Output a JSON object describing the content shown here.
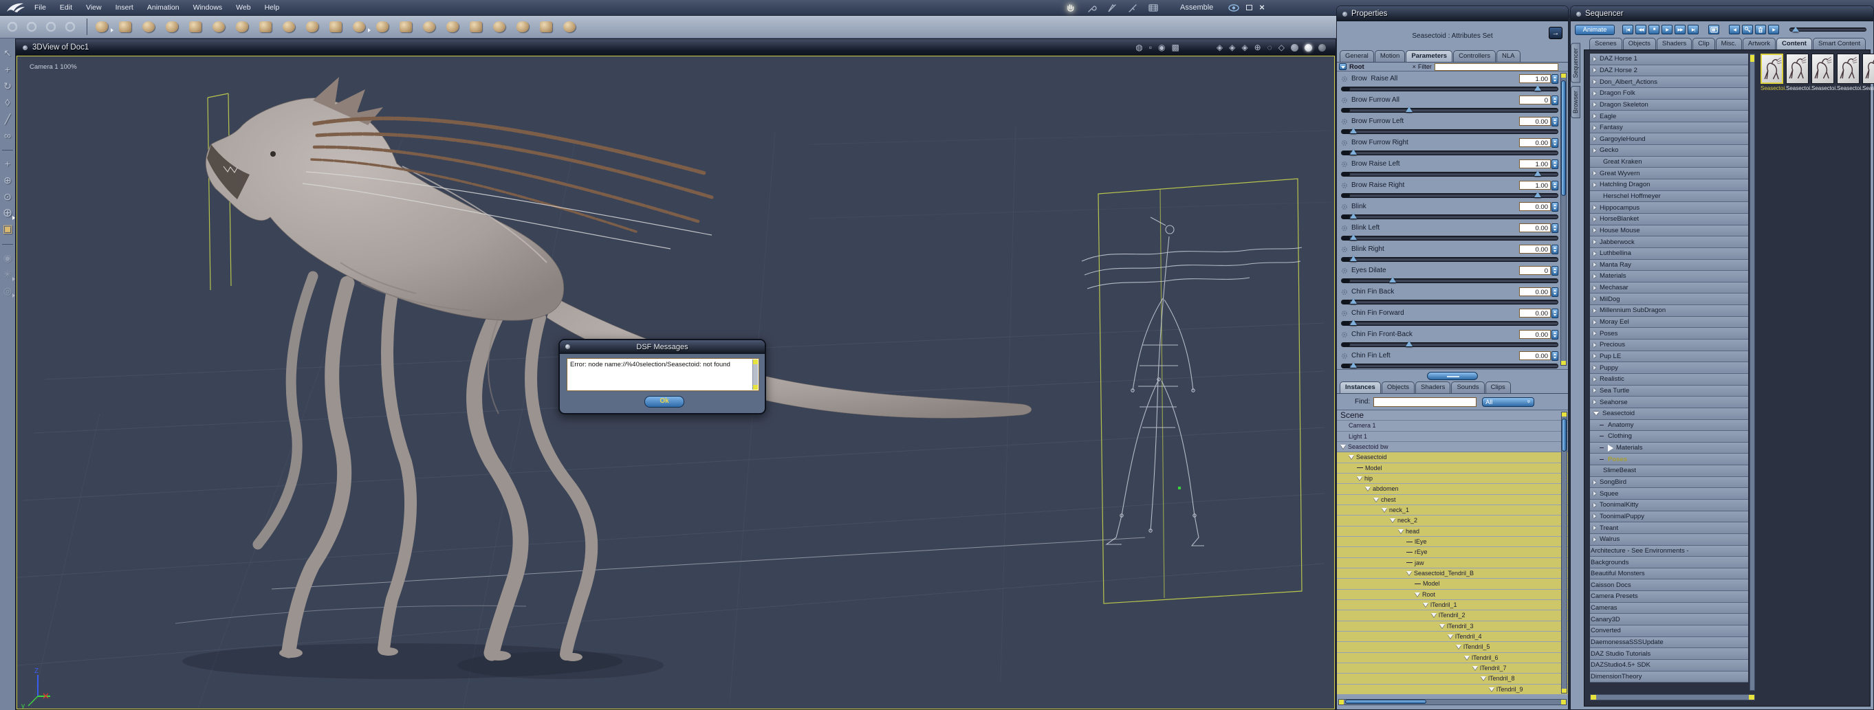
{
  "colors": {
    "accent_blue": "#3a76b4",
    "selection_yellow": "#ddd53f",
    "tree_highlight": "#cdc76a",
    "viewport_bg": "#3b4356"
  },
  "menu_bar": {
    "items": [
      "File",
      "Edit",
      "View",
      "Insert",
      "Animation",
      "Windows",
      "Web",
      "Help"
    ]
  },
  "window": {
    "room_label": "Assemble",
    "room_icons": [
      "hand-room-icon",
      "wrench-room-icon",
      "pen-room-icon",
      "brush-room-icon",
      "film-room-icon"
    ],
    "controls": [
      "eye-icon",
      "maximize-icon",
      "close-icon"
    ]
  },
  "main_toolbar": {
    "dim_tools": [
      "wand-tool-icon",
      "hand-tool-icon",
      "wrench-tool-icon",
      "finger-tool-icon"
    ],
    "insert_tools": [
      {
        "name": "insert-sphere",
        "flyout": true
      },
      {
        "name": "insert-metaball"
      },
      {
        "name": "insert-globe"
      },
      {
        "name": "insert-bone"
      },
      {
        "name": "insert-vertex-object"
      },
      {
        "name": "insert-text"
      },
      {
        "name": "insert-particles"
      },
      {
        "name": "insert-terrain"
      },
      {
        "name": "insert-tree"
      },
      {
        "name": "insert-plant"
      },
      {
        "name": "insert-fire"
      },
      {
        "name": "insert-rock",
        "flyout": true
      },
      {
        "name": "insert-anemone"
      },
      {
        "name": "insert-house"
      },
      {
        "name": "insert-ocean"
      },
      {
        "name": "insert-cloud"
      },
      {
        "name": "insert-figure"
      },
      {
        "name": "insert-camera"
      },
      {
        "name": "insert-person"
      },
      {
        "name": "insert-target"
      },
      {
        "name": "insert-bone-2"
      }
    ]
  },
  "left_toolbar": {
    "tools": [
      {
        "name": "select-arrow-tool"
      },
      {
        "name": "move-tool"
      },
      {
        "name": "rotate-tool"
      },
      {
        "name": "scale-tool"
      },
      {
        "name": "eyedropper-tool"
      },
      {
        "name": "link-tool"
      },
      {
        "name": "divider"
      },
      {
        "name": "pan-camera-tool"
      },
      {
        "name": "orbit-camera-tool"
      },
      {
        "name": "sweep-camera-tool"
      },
      {
        "name": "trackball-camera-tool",
        "flyout": true
      },
      {
        "name": "room-view-tool"
      },
      {
        "name": "divider"
      },
      {
        "name": "render-camera-tool",
        "dim": true
      },
      {
        "name": "hand-pan-tool",
        "dim": true,
        "flyout": true
      },
      {
        "name": "zoom-tool",
        "dim": true,
        "flyout": true
      }
    ]
  },
  "viewport": {
    "title": "3DView of Doc1",
    "camera_label": "Camera 1 100%",
    "toolbar_icons": [
      "light-toggle-icon",
      "frame-toggle-icon",
      "camera-dot-icon",
      "production-frame-icon",
      "layout-single-icon",
      "layout-split-h-icon",
      "layout-split-3-icon",
      "layout-quad-icon",
      "layout-custom-icon",
      "camera-shield-1-icon",
      "camera-shield-2-icon",
      "camera-shield-3-icon",
      "reset-view-icon",
      "dashed-ball-icon",
      "wire-cube-icon",
      "gray-sphere-icon",
      "white-sphere-icon",
      "textured-sphere-icon"
    ]
  },
  "dialog": {
    "title": "DSF Messages",
    "message": "Error: node name://%40selection/Seasectoid: not found",
    "ok_label": "Ok"
  },
  "properties": {
    "title": "Properties",
    "subtitle": "Seasectoid : Attributes Set",
    "tabs": [
      {
        "label": "General",
        "active": false
      },
      {
        "label": "Motion",
        "active": false
      },
      {
        "label": "Parameters",
        "active": true
      },
      {
        "label": "Controllers",
        "active": false
      },
      {
        "label": "NLA",
        "active": false
      }
    ],
    "root_label": "Root",
    "filter_label": "Filter",
    "filter_value": "",
    "parameters": [
      {
        "label": "Brow  Raise All",
        "value": "1.00",
        "slider": 0.93
      },
      {
        "label": "Brow Furrow All",
        "value": "0",
        "slider": 0.3
      },
      {
        "label": "Brow Furrow Left",
        "value": "0.00",
        "slider": 0.03
      },
      {
        "label": "Brow Furrow Right",
        "value": "0.00",
        "slider": 0.03
      },
      {
        "label": "Brow Raise Left",
        "value": "1.00",
        "slider": 0.93
      },
      {
        "label": "Brow Raise Right",
        "value": "1.00",
        "slider": 0.93
      },
      {
        "label": "Blink",
        "value": "0.00",
        "slider": 0.03
      },
      {
        "label": "Blink Left",
        "value": "0.00",
        "slider": 0.03
      },
      {
        "label": "Blink Right",
        "value": "0.00",
        "slider": 0.03
      },
      {
        "label": "Eyes Dilate",
        "value": "0",
        "slider": 0.22
      },
      {
        "label": "Chin Fin Back",
        "value": "0.00",
        "slider": 0.03
      },
      {
        "label": "Chin Fin Forward",
        "value": "0.00",
        "slider": 0.03
      },
      {
        "label": "Chin Fin Front-Back",
        "value": "0.00",
        "slider": 0.3
      },
      {
        "label": "Chin Fin Left",
        "value": "0.00",
        "slider": 0.03
      }
    ],
    "bottom_tabs": [
      {
        "label": "Instances",
        "active": true
      },
      {
        "label": "Objects",
        "active": false
      },
      {
        "label": "Shaders",
        "active": false
      },
      {
        "label": "Sounds",
        "active": false
      },
      {
        "label": "Clips",
        "active": false
      }
    ],
    "find_label": "Find:",
    "find_value": "",
    "find_filter": "All",
    "scene_tree": [
      {
        "label": "Scene",
        "indent": 0,
        "header": true
      },
      {
        "label": "Camera 1",
        "indent": 1
      },
      {
        "label": "Light 1",
        "indent": 1
      },
      {
        "label": "Seasectoid bw",
        "indent": 0,
        "expander": true
      },
      {
        "label": "Seasectoid",
        "indent": 1,
        "expander": true,
        "hl": true
      },
      {
        "label": "Model",
        "indent": 2,
        "dash": true,
        "hl": true
      },
      {
        "label": "hip",
        "indent": 2,
        "expander": true,
        "hl": true
      },
      {
        "label": "abdomen",
        "indent": 3,
        "expander": true,
        "hl": true
      },
      {
        "label": "chest",
        "indent": 4,
        "expander": true,
        "hl": true
      },
      {
        "label": "neck_1",
        "indent": 5,
        "expander": true,
        "hl": true
      },
      {
        "label": "neck_2",
        "indent": 6,
        "expander": true,
        "hl": true
      },
      {
        "label": "head",
        "indent": 7,
        "expander": true,
        "hl": true
      },
      {
        "label": "lEye",
        "indent": 8,
        "dash": true,
        "hl": true
      },
      {
        "label": "rEye",
        "indent": 8,
        "dash": true,
        "hl": true
      },
      {
        "label": "jaw",
        "indent": 8,
        "dash": true,
        "hl": true
      },
      {
        "label": "Seasectoid_Tendril_B",
        "indent": 8,
        "expander": true,
        "hl": true
      },
      {
        "label": "Model",
        "indent": 9,
        "dash": true,
        "hl": true
      },
      {
        "label": "Root",
        "indent": 9,
        "expander": true,
        "hl": true
      },
      {
        "label": "lTendril_1",
        "indent": 10,
        "expander": true,
        "hl": true
      },
      {
        "label": "lTendril_2",
        "indent": 11,
        "expander": true,
        "hl": true
      },
      {
        "label": "lTendril_3",
        "indent": 12,
        "expander": true,
        "hl": true
      },
      {
        "label": "lTendril_4",
        "indent": 13,
        "expander": true,
        "hl": true
      },
      {
        "label": "lTendril_5",
        "indent": 14,
        "expander": true,
        "hl": true
      },
      {
        "label": "lTendril_6",
        "indent": 15,
        "expander": true,
        "hl": true
      },
      {
        "label": "lTendril_7",
        "indent": 16,
        "expander": true,
        "hl": true
      },
      {
        "label": "lTendril_8",
        "indent": 17,
        "expander": true,
        "hl": true
      },
      {
        "label": "lTendril_9",
        "indent": 18,
        "expander": true,
        "hl": true
      }
    ]
  },
  "sequencer": {
    "title": "Sequencer",
    "animate_label": "Animate",
    "side_tabs": [
      "Sequencer",
      "Browser"
    ],
    "transport": [
      "rewind-start",
      "rewind",
      "stop",
      "play",
      "fast-forward",
      "forward-end",
      "gap",
      "render-preview",
      "gap",
      "prev-key",
      "key",
      "delete-key",
      "next-key"
    ],
    "tabs": [
      {
        "label": "Scenes"
      },
      {
        "label": "Objects"
      },
      {
        "label": "Shaders"
      },
      {
        "label": "Clip"
      },
      {
        "label": "Misc."
      },
      {
        "label": "Artwork"
      },
      {
        "label": "Content",
        "active": true
      },
      {
        "label": "Smart Content"
      }
    ],
    "folders": [
      {
        "label": "DAZ Horse 1",
        "arrow": true
      },
      {
        "label": "DAZ Horse 2",
        "arrow": true
      },
      {
        "label": "Don_Albert_Actions",
        "arrow": true
      },
      {
        "label": "Dragon Folk",
        "arrow": true
      },
      {
        "label": "Dragon Skeleton",
        "arrow": true
      },
      {
        "label": "Eagle",
        "arrow": true
      },
      {
        "label": "Fantasy",
        "arrow": true
      },
      {
        "label": "GargoyleHound",
        "arrow": true
      },
      {
        "label": "Gecko",
        "arrow": true
      },
      {
        "label": "Great Kraken",
        "arrow": false
      },
      {
        "label": "Great Wyvern",
        "arrow": true
      },
      {
        "label": "Hatchling Dragon",
        "arrow": true
      },
      {
        "label": "Herschel Hoffmeyer",
        "arrow": false
      },
      {
        "label": "Hippocampus",
        "arrow": true
      },
      {
        "label": "HorseBlanket",
        "arrow": true
      },
      {
        "label": "House Mouse",
        "arrow": true
      },
      {
        "label": "Jabberwock",
        "arrow": true
      },
      {
        "label": "Luthbellina",
        "arrow": true
      },
      {
        "label": "Manta Ray",
        "arrow": true
      },
      {
        "label": "Materials",
        "arrow": true
      },
      {
        "label": "Mechasar",
        "arrow": true
      },
      {
        "label": "MilDog",
        "arrow": true
      },
      {
        "label": "Millennium SubDragon",
        "arrow": true
      },
      {
        "label": "Moray Eel",
        "arrow": true
      },
      {
        "label": "Poses",
        "arrow": true
      },
      {
        "label": "Precious",
        "arrow": true
      },
      {
        "label": "Pup LE",
        "arrow": true
      },
      {
        "label": "Puppy",
        "arrow": true
      },
      {
        "label": "Realistic",
        "arrow": true
      },
      {
        "label": "Sea Turtle",
        "arrow": true
      },
      {
        "label": "Seahorse",
        "arrow": true
      },
      {
        "label": "Seasectoid",
        "arrow": true,
        "expanded": true
      },
      {
        "label": "Anatomy",
        "child": true
      },
      {
        "label": "Clothing",
        "child": true
      },
      {
        "label": "Materials",
        "child": true,
        "drop": true
      },
      {
        "label": "Poses",
        "child": true,
        "selected": true
      },
      {
        "label": "SlimeBeast",
        "arrow": false
      },
      {
        "label": "SongBird",
        "arrow": true
      },
      {
        "label": "Squee",
        "arrow": true
      },
      {
        "label": "ToonimalKitty",
        "arrow": true
      },
      {
        "label": "ToonimalPuppy",
        "arrow": true
      },
      {
        "label": "Treant",
        "arrow": true
      },
      {
        "label": "Walrus",
        "arrow": true
      },
      {
        "label": "Architecture - See Environments -",
        "shifted": true
      },
      {
        "label": "Backgrounds",
        "shifted": true
      },
      {
        "label": "Beautiful Monsters",
        "shifted": true
      },
      {
        "label": "Caisson Docs",
        "shifted": true
      },
      {
        "label": "Camera Presets",
        "shifted": true
      },
      {
        "label": "Cameras",
        "shifted": true
      },
      {
        "label": "Canary3D",
        "shifted": true
      },
      {
        "label": "Converted",
        "shifted": true
      },
      {
        "label": "DaemonessaSSSUpdate",
        "shifted": true
      },
      {
        "label": "DAZ Studio Tutorials",
        "shifted": true
      },
      {
        "label": "DAZStudio4.5+ SDK",
        "shifted": true
      },
      {
        "label": "DimensionTheory",
        "shifted": true
      }
    ],
    "thumbnails": [
      {
        "label": "Seasectoi.",
        "selected": true
      },
      {
        "label": "Seasectoi.",
        "selected": false
      },
      {
        "label": "Seasectoi.",
        "selected": false
      },
      {
        "label": "Seasectoi.",
        "selected": false
      },
      {
        "label": "Seasectoi.",
        "selected": false
      }
    ]
  }
}
